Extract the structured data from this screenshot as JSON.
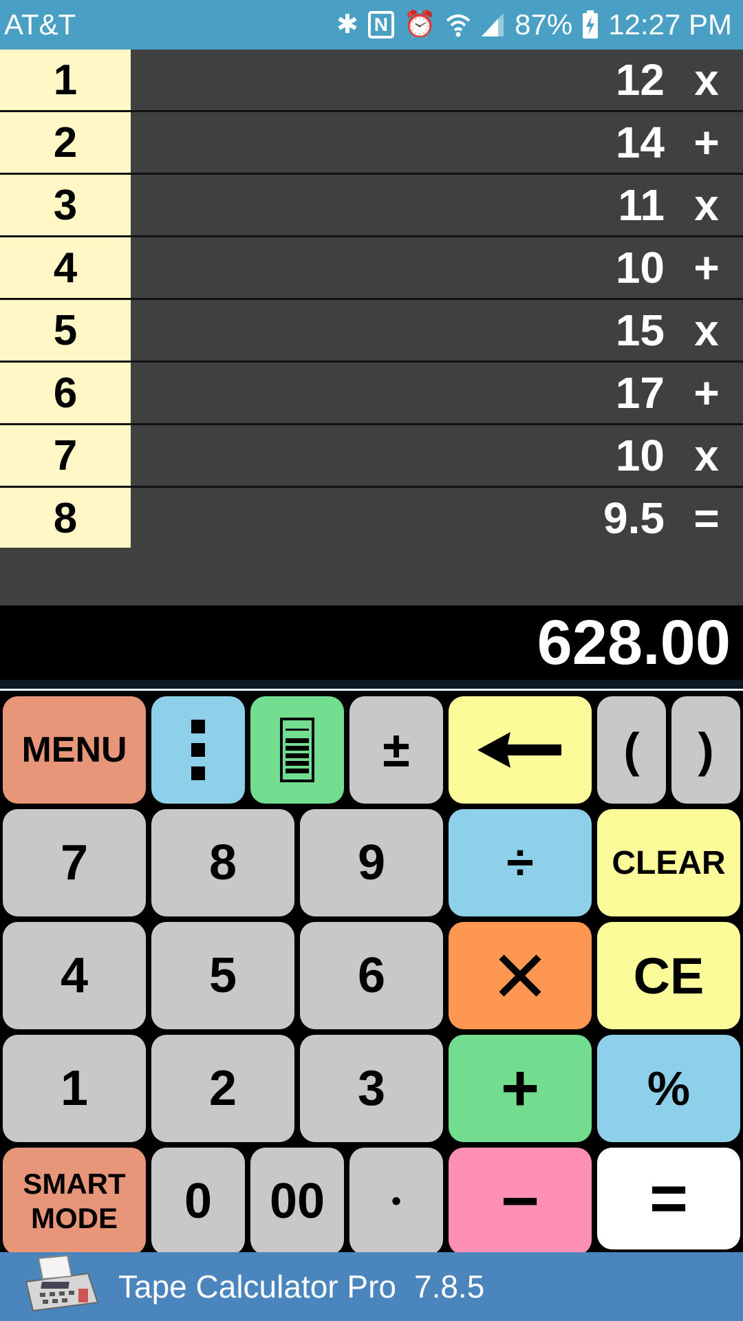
{
  "status": {
    "carrier": "AT&T",
    "battery": "87%",
    "time": "12:27 PM",
    "icons": [
      "bluetooth-icon",
      "nfc-icon",
      "alarm-icon",
      "wifi-icon",
      "signal-icon",
      "battery-charging-icon"
    ],
    "nfc_letter": "N",
    "bluetooth_glyph": "✱",
    "alarm_glyph": "⏰"
  },
  "tape": [
    {
      "num": "1",
      "value": "12",
      "op": "x"
    },
    {
      "num": "2",
      "value": "14",
      "op": "+"
    },
    {
      "num": "3",
      "value": "11",
      "op": "x"
    },
    {
      "num": "4",
      "value": "10",
      "op": "+"
    },
    {
      "num": "5",
      "value": "15",
      "op": "x"
    },
    {
      "num": "6",
      "value": "17",
      "op": "+"
    },
    {
      "num": "7",
      "value": "10",
      "op": "x"
    },
    {
      "num": "8",
      "value": "9.5",
      "op": "="
    }
  ],
  "result": "628.00",
  "keys": {
    "menu": "MENU",
    "more": "⋮",
    "tape_icon": "tape-view-icon",
    "plus_minus": "±",
    "backspace_icon": "backspace-arrow-icon",
    "paren_open": "(",
    "paren_close": ")",
    "seven": "7",
    "eight": "8",
    "nine": "9",
    "divide": "÷",
    "clear": "CLEAR",
    "four": "4",
    "five": "5",
    "six": "6",
    "multiply_icon": "multiply-icon",
    "ce": "CE",
    "one": "1",
    "two": "2",
    "three": "3",
    "plus": "+",
    "percent": "%",
    "smart_line1": "SMART",
    "smart_line2": "MODE",
    "zero": "0",
    "double_zero": "00",
    "decimal": "•",
    "minus": "−",
    "equals": "="
  },
  "colors": {
    "status_bar": "#4a9fc4",
    "tape_number_bg": "#fff7c6",
    "tape_bg": "#404040",
    "key_gray": "#c8c8c8",
    "key_salmon": "#e8967a",
    "key_blue": "#8ecfea",
    "key_green": "#72dd8f",
    "key_yellow": "#fbfb9a",
    "key_orange": "#fd9752",
    "key_pink": "#fe8fb6",
    "footer": "#4a86bd"
  },
  "footer": {
    "app_name": "Tape Calculator Pro",
    "version": "7.8.5",
    "icon": "calculator-machine-icon"
  }
}
